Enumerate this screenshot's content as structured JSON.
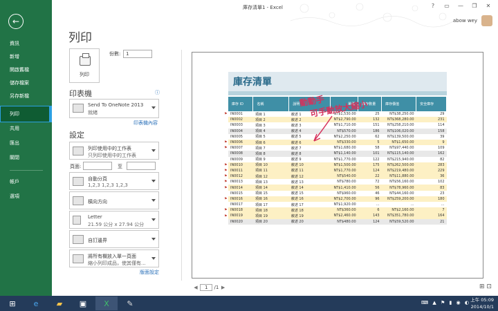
{
  "window": {
    "title": "庫存清單1 - Excel",
    "controls": {
      "help": "?",
      "minimize": "—",
      "restore": "❐",
      "close": "✕"
    },
    "user": "abow wey"
  },
  "sidebar": {
    "back_glyph": "←",
    "items": [
      {
        "label": "資訊"
      },
      {
        "label": "新增"
      },
      {
        "label": "開啟舊檔"
      },
      {
        "label": "儲存檔案"
      },
      {
        "label": "另存新檔"
      },
      {
        "label": "列印",
        "active": true
      },
      {
        "label": "共用"
      },
      {
        "label": "匯出"
      },
      {
        "label": "關閉"
      },
      {
        "label": "帳戶"
      },
      {
        "label": "選項"
      }
    ]
  },
  "print": {
    "page_title": "列印",
    "print_button": "列印",
    "copies_label": "份數:",
    "copies_value": "1",
    "printer_heading": "印表機",
    "printer_name": "Send To OneNote 2013",
    "printer_status": "就緒",
    "printer_properties_link": "印表機內容",
    "settings_heading": "設定",
    "settings": [
      {
        "line1": "列印使用中的工作表",
        "line2": "只列印使用中的工作表"
      },
      {
        "line1": "自動分頁",
        "line2": "1,2,3    1,2,3    1,2,3"
      },
      {
        "line1": "橫向方向",
        "line2": ""
      },
      {
        "line1": "Letter",
        "line2": "21.59 公分 x 27.94 公分"
      },
      {
        "line1": "自訂邊界",
        "line2": ""
      },
      {
        "line1": "將所有欄放入單一頁面",
        "line2": "縮小列印成品，使其僅有..."
      }
    ],
    "pages_label": "頁面:",
    "pages_to_label": "至",
    "page_setup_link": "版面設定"
  },
  "preview": {
    "sheet_title": "庫存清單",
    "headers": [
      "庫存 ID",
      "名稱",
      "說明",
      "單價",
      "庫存數量",
      "庫存價值",
      "安全庫存"
    ],
    "rows": [
      [
        "IN0001",
        "項目 1",
        "敘述 1",
        "NT$1,530.00",
        "25",
        "NT$38,250.00",
        "29"
      ],
      [
        "IN0002",
        "項目 2",
        "敘述 2",
        "NT$2,790.00",
        "132",
        "NT$368,280.00",
        "231"
      ],
      [
        "IN0003",
        "項目 3",
        "敘述 3",
        "NT$1,710.00",
        "151",
        "NT$258,210.00",
        "114"
      ],
      [
        "IN0004",
        "項目 4",
        "敘述 4",
        "NT$570.00",
        "186",
        "NT$106,020.00",
        "158"
      ],
      [
        "IN0005",
        "項目 5",
        "敘述 5",
        "NT$2,250.00",
        "62",
        "NT$139,500.00",
        "39"
      ],
      [
        "IN0006",
        "項目 6",
        "敘述 6",
        "NT$330.00",
        "5",
        "NT$1,650.00",
        "9"
      ],
      [
        "IN0007",
        "項目 7",
        "敘述 7",
        "NT$1,680.00",
        "58",
        "NT$97,440.00",
        "109"
      ],
      [
        "IN0008",
        "項目 8",
        "敘述 8",
        "NT$1,140.00",
        "101",
        "NT$115,140.00",
        "162"
      ],
      [
        "IN0009",
        "項目 9",
        "敘述 9",
        "NT$1,770.00",
        "122",
        "NT$215,940.00",
        "82"
      ],
      [
        "IN0010",
        "項目 10",
        "敘述 10",
        "NT$1,500.00",
        "175",
        "NT$262,500.00",
        "283"
      ],
      [
        "IN0011",
        "項目 11",
        "敘述 11",
        "NT$1,770.00",
        "124",
        "NT$219,480.00",
        "229"
      ],
      [
        "IN0012",
        "項目 12",
        "敘述 12",
        "NT$540.00",
        "22",
        "NT$11,880.00",
        "36"
      ],
      [
        "IN0013",
        "項目 13",
        "敘述 13",
        "NT$780.00",
        "72",
        "NT$56,160.00",
        "102"
      ],
      [
        "IN0014",
        "項目 14",
        "敘述 14",
        "NT$1,410.00",
        "56",
        "NT$78,960.00",
        "83"
      ],
      [
        "IN0015",
        "項目 15",
        "敘述 15",
        "NT$960.00",
        "46",
        "NT$44,160.00",
        "23"
      ],
      [
        "IN0016",
        "項目 16",
        "敘述 16",
        "NT$2,700.00",
        "96",
        "NT$259,200.00",
        "180"
      ],
      [
        "IN0017",
        "項目 17",
        "敘述 17",
        "NT$1,920.00",
        "...",
        "...",
        "..."
      ],
      [
        "IN0018",
        "項目 18",
        "敘述 18",
        "NT$360.00",
        "6",
        "NT$2,160.00",
        "7"
      ],
      [
        "IN0019",
        "項目 19",
        "敘述 19",
        "NT$2,460.00",
        "143",
        "NT$351,780.00",
        "164"
      ],
      [
        "IN0020",
        "項目 20",
        "敘述 20",
        "NT$480.00",
        "124",
        "NT$59,520.00",
        "21"
      ]
    ],
    "annotation": "動動手 可手動放大縮小",
    "page_current": "1",
    "page_total": "/1"
  },
  "taskbar": {
    "start_glyph": "⊞",
    "clock_time": "上午 05:09",
    "clock_date": "2014/10/1"
  },
  "colors": {
    "sidebar": "#217346",
    "header": "#3f8fa6",
    "accent": "#2ca0e2"
  }
}
